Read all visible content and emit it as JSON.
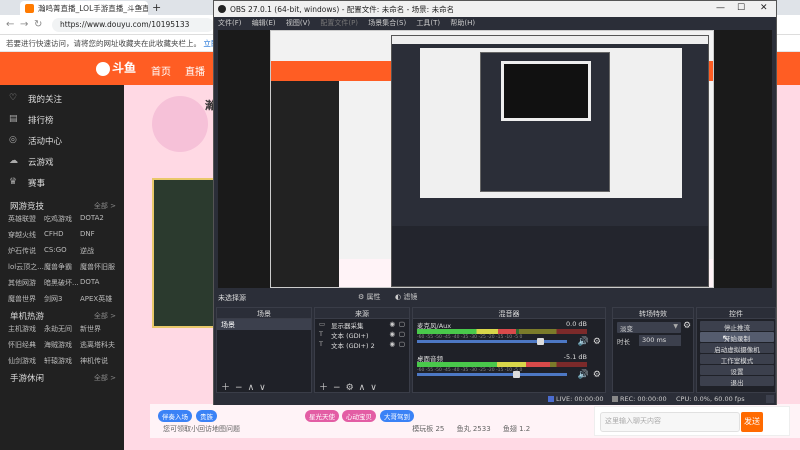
{
  "browser": {
    "tab_title": "瀚鸣菁直播_LOL手游直播_斗鱼直",
    "new_tab": "+",
    "url": "https://www.douyu.com/10195133",
    "info_text": "若要进行快速访问，请将您的网址收藏夹在此收藏夹栏上。",
    "info_link": "立即管理收藏夹"
  },
  "site": {
    "logo": "斗鱼",
    "nav": [
      "首页",
      "直播"
    ],
    "sidebar_items": [
      {
        "label": "我的关注",
        "icon": "heart-icon"
      },
      {
        "label": "排行榜",
        "icon": "rank-icon"
      },
      {
        "label": "活动中心",
        "icon": "activity-icon"
      },
      {
        "label": "云游戏",
        "icon": "cloud-game-icon"
      },
      {
        "label": "赛事",
        "icon": "trophy-icon"
      }
    ],
    "groups": [
      {
        "title": "网游竞技",
        "more": "全部 >",
        "items": [
          "英雄联盟",
          "吃鸡游戏",
          "DOTA2",
          "穿越火线",
          "CFHD",
          "DNF",
          "炉石传说",
          "CS:GO",
          "逆战",
          "lol云顶之...",
          "魔兽争霸",
          "魔兽怀旧服",
          "其他网游",
          "暗黑破坏...",
          "DOTA",
          "魔兽世界",
          "剑网3",
          "APEX英雄"
        ]
      },
      {
        "title": "单机热游",
        "more": "全部 >",
        "items": [
          "主机游戏",
          "永劫无间",
          "新世界",
          "怀旧经典",
          "海贼游戏",
          "逃离塔科夫",
          "仙剑游戏",
          "轩辕游戏",
          "神机传说"
        ]
      },
      {
        "title": "手游休闲",
        "more": "全部 >",
        "items": []
      }
    ],
    "streamer_title": "瀚",
    "chips": [
      "伴奏入场",
      "贵族",
      "星光天使",
      "心动宝贝",
      "大哥驾到"
    ],
    "chat_placeholder": "这里输入聊天内容",
    "send": "发送",
    "msg_text": "您可领取小回访地图问题",
    "fans_a": "模玩板 25",
    "fans_b": "鱼丸 2533",
    "fans_c": "鱼翅 1.2"
  },
  "obs": {
    "window_title": "OBS 27.0.1 (64-bit, windows) - 配置文件: 未命名 - 场景: 未命名",
    "menu": [
      "文件(F)",
      "编辑(E)",
      "视图(V)",
      "配置文件(P)",
      "场景集合(S)",
      "工具(T)",
      "帮助(H)"
    ],
    "no_source_selected": "未选择源",
    "properties": "属性",
    "filters": "滤镜",
    "docks": {
      "scenes": "场景",
      "sources": "来源",
      "mixer": "混音器",
      "transitions": "转场特效",
      "controls": "控件"
    },
    "scene_list": [
      "场景"
    ],
    "sources": [
      {
        "name": "显示器采集",
        "icon": "monitor-icon"
      },
      {
        "name": "文本 (GDI+)",
        "icon": "text-icon"
      },
      {
        "name": "文本 (GDI+) 2",
        "icon": "text-icon"
      }
    ],
    "mixer": [
      {
        "name": "麦克风/Aux",
        "db": "0.0 dB",
        "level": 0.58,
        "volume": 0.82
      },
      {
        "name": "桌面音频",
        "db": "-5.1 dB",
        "level": 0.78,
        "volume": 0.66
      }
    ],
    "meter_ticks": "-60 -55 -50 -45 -40 -35 -30 -25 -20 -15 -10 -5 0",
    "transition": {
      "type": "淡变",
      "duration_label": "时长",
      "duration": "300 ms"
    },
    "controls": [
      "停止推流",
      "开始录制",
      "启动虚拟摄像机",
      "工作室模式",
      "设置",
      "退出"
    ],
    "active_control": "开始录制",
    "status": {
      "live": "LIVE: 00:00:00",
      "rec": "REC: 00:00:00",
      "cpu": "CPU: 0.0%, 60.00 fps"
    }
  },
  "colors": {
    "brand_orange": "#ff5d23",
    "obs_bg": "#2b2e38",
    "meter_green": "#49c84b",
    "slider_blue": "#4d78c4"
  }
}
